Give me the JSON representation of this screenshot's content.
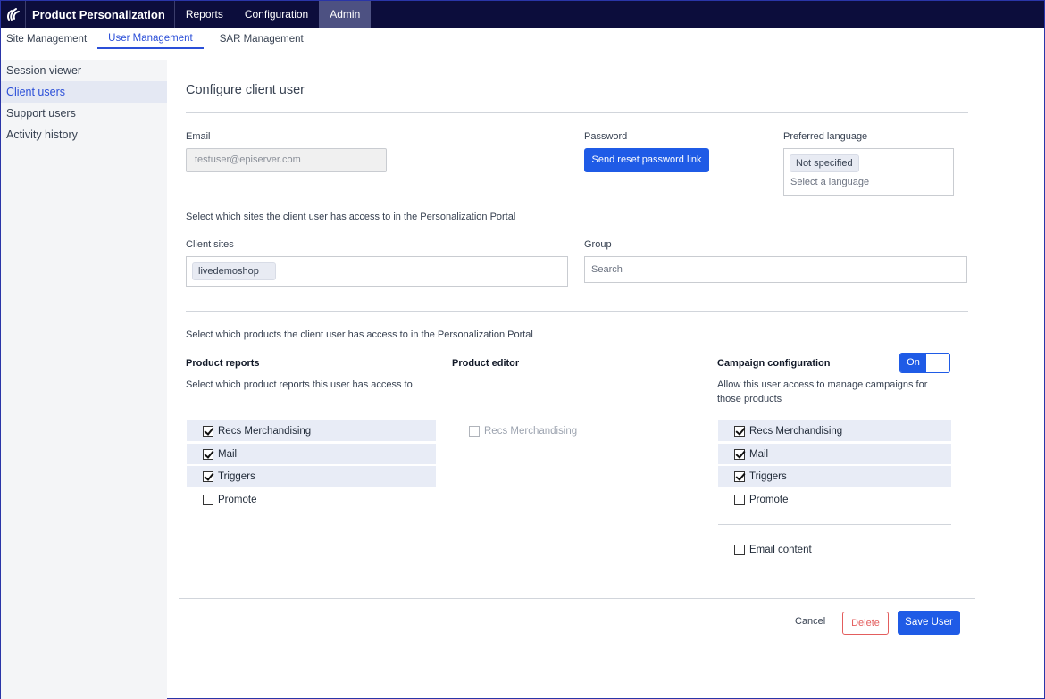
{
  "topbar": {
    "brand": "Product Personalization",
    "nav": [
      "Reports",
      "Configuration",
      "Admin"
    ]
  },
  "subtabs": [
    "Site Management",
    "User Management",
    "SAR Management"
  ],
  "sidebar": [
    "Session viewer",
    "Client users",
    "Support users",
    "Activity history"
  ],
  "form": {
    "title": "Configure client user",
    "email_label": "Email",
    "email_value": "testuser@episerver.com",
    "password_label": "Password",
    "reset_button": "Send reset password link",
    "language_label": "Preferred language",
    "language_chip": "Not specified",
    "language_placeholder": "Select a language",
    "sites_intro": "Select which sites the client user has access to in the Personalization Portal",
    "client_sites_label": "Client sites",
    "client_site_chip": "livedemoshop",
    "group_label": "Group",
    "group_placeholder": "Search",
    "products_intro": "Select which products the client user has access to in the Personalization Portal"
  },
  "product_reports": {
    "title": "Product reports",
    "desc": "Select which product reports this user has access to",
    "items": [
      {
        "label": "Recs Merchandising",
        "checked": true
      },
      {
        "label": "Mail",
        "checked": true
      },
      {
        "label": "Triggers",
        "checked": true
      },
      {
        "label": "Promote",
        "checked": false
      }
    ]
  },
  "product_editor": {
    "title": "Product editor",
    "items": [
      {
        "label": "Recs Merchandising",
        "checked": false,
        "disabled": true
      }
    ]
  },
  "campaign_config": {
    "title": "Campaign configuration",
    "toggle": "On",
    "desc_line1": "Allow this user access to manage campaigns for",
    "desc_line2": "those products",
    "items": [
      {
        "label": "Recs Merchandising",
        "checked": true
      },
      {
        "label": "Mail",
        "checked": true
      },
      {
        "label": "Triggers",
        "checked": true
      },
      {
        "label": "Promote",
        "checked": false
      }
    ],
    "email_content": {
      "label": "Email content",
      "checked": false
    }
  },
  "actions": {
    "cancel": "Cancel",
    "delete": "Delete",
    "save": "Save User"
  },
  "colors": {
    "topbar": "#0c0d3c",
    "accent": "#1f5be6",
    "danger": "#e35d5d"
  }
}
